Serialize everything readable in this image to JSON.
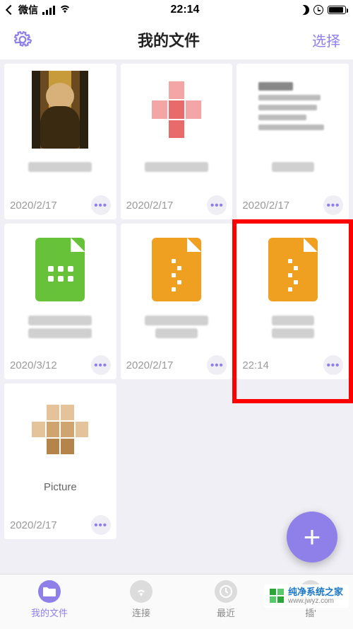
{
  "status": {
    "app": "微信",
    "time": "22:14"
  },
  "header": {
    "title": "我的文件",
    "select": "选择"
  },
  "files": [
    {
      "date": "2020/2/17"
    },
    {
      "date": "2020/2/17"
    },
    {
      "date": "2020/2/17"
    },
    {
      "date": "2020/3/12"
    },
    {
      "date": "2020/2/17"
    },
    {
      "date": "22:14"
    },
    {
      "name": "Picture",
      "date": "2020/2/17"
    }
  ],
  "tabs": {
    "myfiles": "我的文件",
    "connect": "连接",
    "recent": "最近",
    "plugins": "插'"
  },
  "watermark": {
    "title": "纯净系统之家",
    "url": "www.jwyz.com"
  },
  "colors": {
    "accent": "#8f7fe9",
    "highlight": "#ff0000"
  }
}
